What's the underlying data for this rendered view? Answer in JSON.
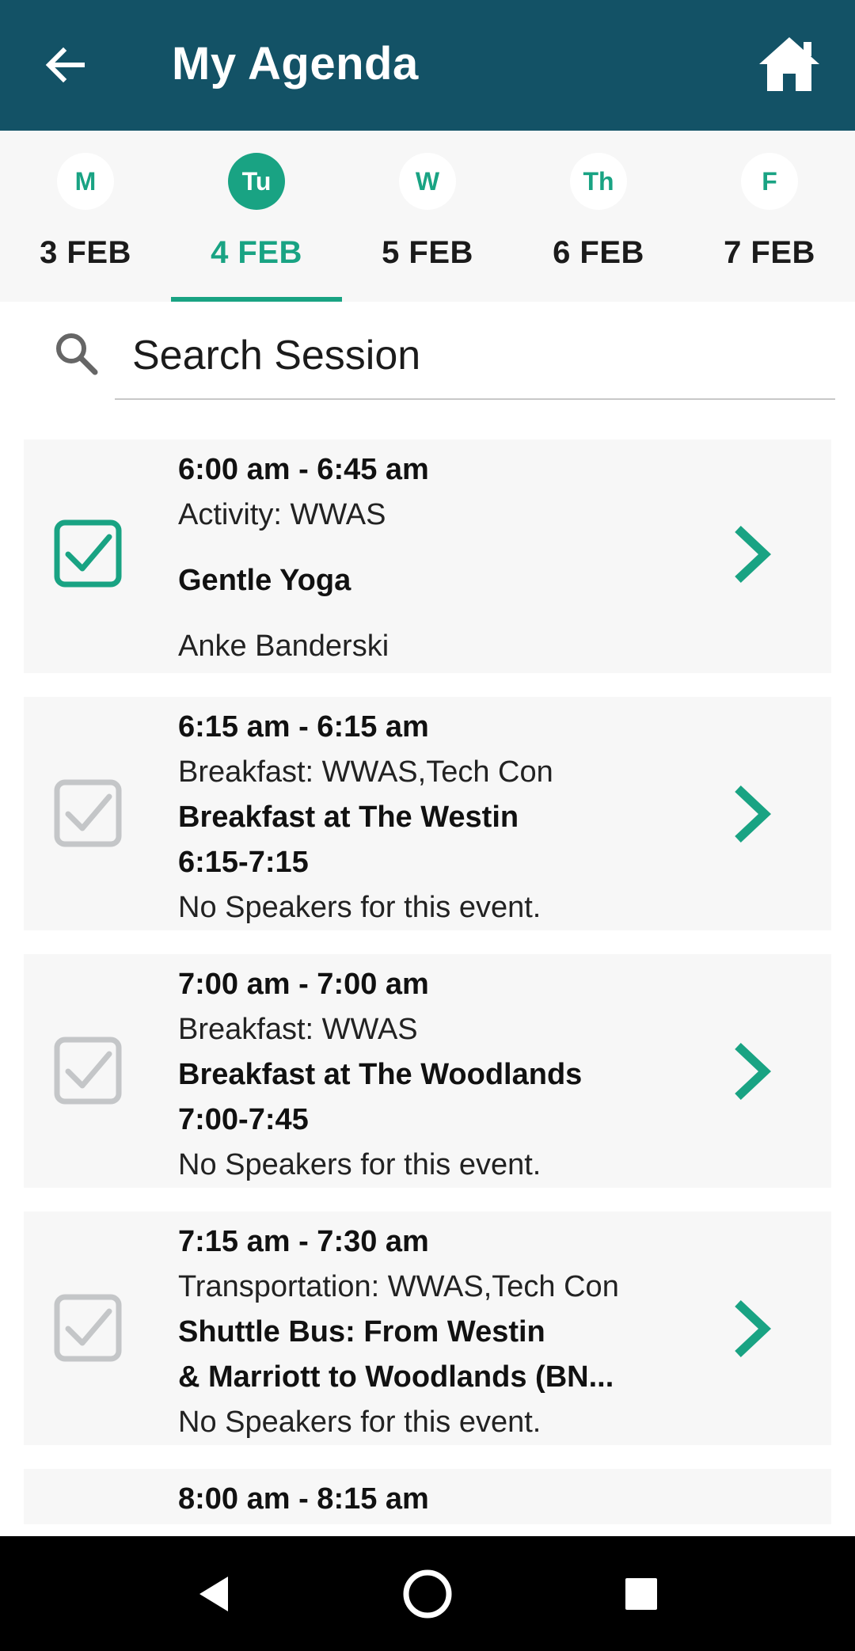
{
  "header": {
    "title": "My Agenda",
    "back_icon": "arrow-left-icon",
    "home_icon": "home-icon",
    "background": "#135266"
  },
  "days": [
    {
      "abbr": "M",
      "date": "3 FEB",
      "active": false
    },
    {
      "abbr": "Tu",
      "date": "4 FEB",
      "active": true
    },
    {
      "abbr": "W",
      "date": "5 FEB",
      "active": false
    },
    {
      "abbr": "Th",
      "date": "6 FEB",
      "active": false
    },
    {
      "abbr": "F",
      "date": "7 FEB",
      "active": false
    }
  ],
  "search": {
    "placeholder": "Search Session",
    "icon": "search-icon"
  },
  "sessions": [
    {
      "time": "6:00 am - 6:45 am",
      "type": "Activity: WWAS",
      "title_lines": [
        "Gentle Yoga"
      ],
      "speaker": "Anke Banderski",
      "checked": true
    },
    {
      "time": "6:15 am - 6:15 am",
      "type": "Breakfast: WWAS,Tech Con",
      "title_lines": [
        "Breakfast at The Westin",
        "6:15-7:15"
      ],
      "speaker": "No Speakers for this event.",
      "checked": false
    },
    {
      "time": "7:00 am - 7:00 am",
      "type": "Breakfast: WWAS",
      "title_lines": [
        "Breakfast at The Woodlands",
        "7:00-7:45"
      ],
      "speaker": "No Speakers for this event.",
      "checked": false
    },
    {
      "time": "7:15 am - 7:30 am",
      "type": "Transportation: WWAS,Tech Con",
      "title_lines": [
        "Shuttle Bus: From Westin",
        "& Marriott to Woodlands (BN..."
      ],
      "speaker": "No Speakers for this event.",
      "checked": false
    },
    {
      "time": "8:00 am - 8:15 am"
    }
  ],
  "colors": {
    "accent": "#19a383",
    "card_bg": "#f7f7f7",
    "checkbox_unchecked": "#c4c6c8"
  },
  "navbar": {
    "back_icon": "nav-back-triangle-icon",
    "home_icon": "nav-home-circle-icon",
    "recents_icon": "nav-recents-square-icon"
  }
}
